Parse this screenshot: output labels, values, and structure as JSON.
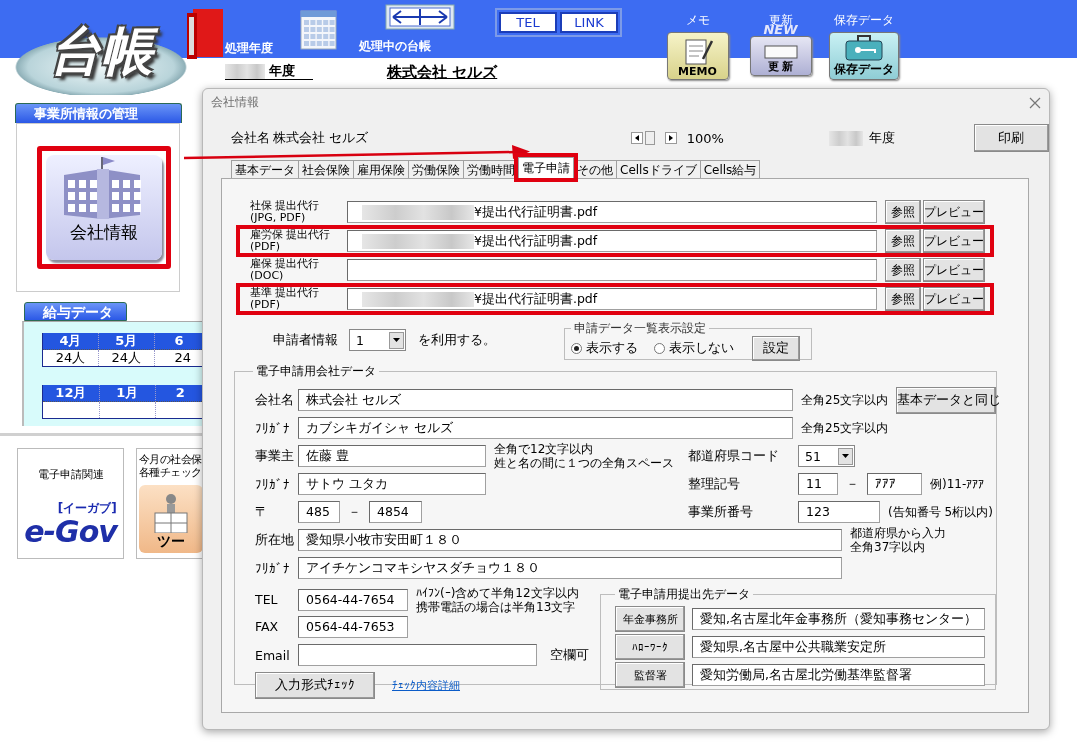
{
  "header": {
    "logo": "台帳",
    "year_label": "処理年度",
    "current_label": "処理中の台帳",
    "link_buttons": [
      "TEL",
      "LINK"
    ],
    "tools": [
      {
        "kind": "memo",
        "label": "メモ",
        "icon_text": "MEMO"
      },
      {
        "kind": "update",
        "label": "更新",
        "icon_text": "更 新",
        "badge": "NEW"
      },
      {
        "kind": "save",
        "label": "保存データ",
        "icon_text": "保存データ"
      }
    ],
    "year_suffix": "年度",
    "company": "株式会社 セルズ"
  },
  "sidebar": {
    "office_panel": {
      "title": "事業所情報の管理",
      "button": {
        "label": "会社情報",
        "highlighted": true
      }
    },
    "salary_panel": {
      "title": "給与データ",
      "tables": [
        {
          "months": [
            "4月",
            "5月",
            "6"
          ],
          "counts": [
            "24人",
            "24人",
            "24"
          ]
        },
        {
          "months": [
            "12月",
            "1月",
            "2"
          ]
        }
      ]
    },
    "cards": [
      {
        "kind": "egov",
        "lines": [
          "電子申請関連"
        ],
        "logo": "e-Gov",
        "logo_caption": "[イーガブ]"
      },
      {
        "kind": "tool",
        "lines": [
          "今月の社会保",
          "各種チェック"
        ],
        "icon_text": "ツー"
      }
    ]
  },
  "dialog": {
    "title": "会社情報",
    "company_label": "会社名",
    "company_name": "株式会社 セルズ",
    "zoom": "100%",
    "year_suffix": "年度",
    "print_button": "印刷",
    "tabs": [
      {
        "label": "基本データ",
        "selected": false,
        "highlighted": false
      },
      {
        "label": "社会保険",
        "selected": false,
        "highlighted": false
      },
      {
        "label": "雇用保険",
        "selected": false,
        "highlighted": false
      },
      {
        "label": "労働保険",
        "selected": false,
        "highlighted": false
      },
      {
        "label": "労働時間",
        "selected": false,
        "highlighted": false
      },
      {
        "label": "電子申請",
        "selected": true,
        "highlighted": true
      },
      {
        "label": "その他",
        "selected": false,
        "highlighted": false
      },
      {
        "label": "Cellsドライブ",
        "selected": false,
        "highlighted": false
      },
      {
        "label": "Cells給与",
        "selected": false,
        "highlighted": false
      }
    ],
    "file_rows": [
      {
        "label": [
          "社保 提出代行",
          "(JPG, PDF)"
        ],
        "redacted": true,
        "value": "¥提出代行証明書.pdf",
        "highlighted": false,
        "buttons": [
          "参照",
          "プレビュー"
        ]
      },
      {
        "label": [
          "雇労保 提出代行",
          "(PDF)"
        ],
        "redacted": true,
        "value": "¥提出代行証明書.pdf",
        "highlighted": true,
        "buttons": [
          "参照",
          "プレビュー"
        ]
      },
      {
        "label": [
          "雇保 提出代行",
          "(DOC)"
        ],
        "redacted": false,
        "highlighted": false,
        "buttons": [
          "参照",
          "プレビュー"
        ]
      },
      {
        "label": [
          "基準 提出代行",
          "(PDF)"
        ],
        "redacted": true,
        "value": "¥提出代行証明書.pdf",
        "highlighted": true,
        "buttons": [
          "参照",
          "プレビュー"
        ]
      }
    ],
    "applicant": {
      "label": "申請者情報",
      "value": "1",
      "suffix": "を利用する。"
    },
    "list_display": {
      "title": "申請データ一覧表示設定",
      "options": [
        {
          "label": "表示する",
          "selected": true
        },
        {
          "label": "表示しない",
          "selected": false
        }
      ],
      "button": "設定"
    },
    "company_data": {
      "title": "電子申請用会社データ",
      "name": {
        "label": "会社名",
        "value": "株式会社 セルズ",
        "hint": "全角25文字以内"
      },
      "same_button": "基本データと同じ",
      "kana": {
        "label": "ﾌﾘｶﾞﾅ",
        "value": "カブシキガイシャ セルズ",
        "hint": "全角25文字以内"
      },
      "owner": {
        "label": "事業主",
        "value": "佐藤 豊",
        "hint": [
          "全角で12文字以内",
          "姓と名の間に１つの全角スペース"
        ]
      },
      "owner_kana": {
        "label": "ﾌﾘｶﾞﾅ",
        "value": "サトウ ユタカ"
      },
      "postal": {
        "label": "〒",
        "values": [
          "485",
          "4854"
        ],
        "separator": "－"
      },
      "pref_code": {
        "label": "都道府県コード",
        "value": "51"
      },
      "ref_code": {
        "label": "整理記号",
        "values": [
          "11",
          "ｱｱｱ"
        ],
        "separator": "－",
        "hint": "例)11-ｱｱｱ"
      },
      "office_no": {
        "label": "事業所番号",
        "value": "123",
        "hint": "(告知番号 5桁以内)"
      },
      "address": {
        "label": "所在地",
        "value": "愛知県小牧市安田町１８０",
        "hint": [
          "都道府県から入力",
          "全角37字以内"
        ]
      },
      "address_kana": {
        "label": "ﾌﾘｶﾞﾅ",
        "value": "アイチケンコマキシヤスダチョウ１８０"
      },
      "tel": {
        "label": "TEL",
        "value": "0564-44-7654"
      },
      "tel_hint": [
        "ﾊｲﾌﾝ(ｰ)含めて半角12文字以内",
        "携帯電話の場合は半角13文字"
      ],
      "fax": {
        "label": "FAX",
        "value": "0564-44-7653"
      },
      "email": {
        "label": "Email",
        "hint": "空欄可"
      },
      "check_button": "入力形式ﾁｪｯｸ",
      "check_link": "ﾁｪｯｸ内容詳細",
      "destinations": {
        "title": "電子申請用提出先データ",
        "rows": [
          {
            "button": "年金事務所",
            "value": "愛知,名古屋北年金事務所（愛知事務センター）"
          },
          {
            "button": "ﾊﾛｰﾜｰｸ",
            "value": "愛知県,名古屋中公共職業安定所"
          },
          {
            "button": "監督署",
            "value": "愛知労働局,名古屋北労働基準監督署"
          }
        ]
      }
    }
  }
}
